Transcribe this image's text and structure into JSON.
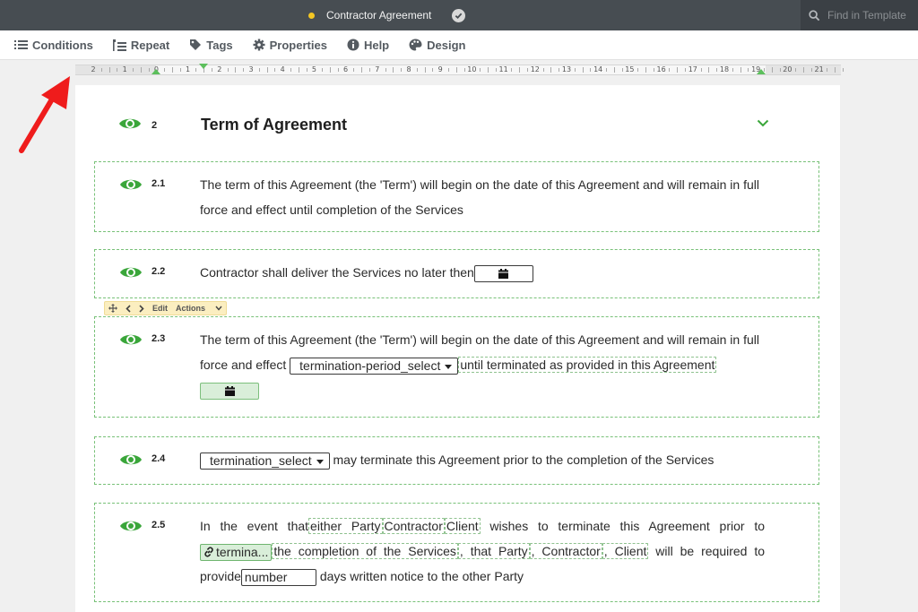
{
  "header": {
    "doc_title": "Contractor Agreement",
    "search_placeholder": "Find in Template"
  },
  "toolbar": [
    {
      "label": "Conditions",
      "icon": "list-icon"
    },
    {
      "label": "Repeat",
      "icon": "repeat-icon"
    },
    {
      "label": "Tags",
      "icon": "tag-icon"
    },
    {
      "label": "Properties",
      "icon": "gear-icon"
    },
    {
      "label": "Help",
      "icon": "info-icon"
    },
    {
      "label": "Design",
      "icon": "palette-icon"
    }
  ],
  "ruler": {
    "labels": [
      "2",
      "1",
      "0",
      "1",
      "2",
      "3",
      "4",
      "5",
      "6",
      "7",
      "8",
      "9",
      "10",
      "11",
      "12",
      "13",
      "14",
      "15",
      "16",
      "17",
      "18",
      "19",
      "20",
      "21"
    ]
  },
  "section": {
    "number": "2",
    "title": "Term of Agreement"
  },
  "clause_toolbar": {
    "edit": "Edit",
    "actions": "Actions"
  },
  "clauses": [
    {
      "number": "2.1",
      "text": "The term of this Agreement (the 'Term') will begin on the date of this Agreement and will remain in full force and effect until completion of the Services"
    },
    {
      "number": "2.2",
      "text": "Contractor shall deliver the Services no later then"
    },
    {
      "number": "2.3",
      "text_a": "The term of this Agreement (the 'Term') will begin on the date of this Agreement and will remain in full force and effect",
      "select": "termination-period_select",
      "text_b": "until terminated as provided in this Agreement"
    },
    {
      "number": "2.4",
      "select": "termination_select",
      "text": "may terminate this Agreement prior to the completion of the Services"
    },
    {
      "number": "2.5",
      "t1": "In the event that",
      "opt1": "either Party",
      "opt2": "Contractor",
      "opt3": "Client",
      "t2": "wishes to terminate this Agreement prior to",
      "link": "termina...",
      "t3": "the completion of the Services",
      "t4": ", that Party",
      "t5": ", Contractor",
      "t6": ", Client",
      "t7": "will be required to provide",
      "number_field": "number",
      "t8": "days written notice to the other Party"
    }
  ],
  "colors": {
    "accent_green": "#3aa63a",
    "titlebar": "#474d52",
    "dashed_border": "#78c178"
  }
}
